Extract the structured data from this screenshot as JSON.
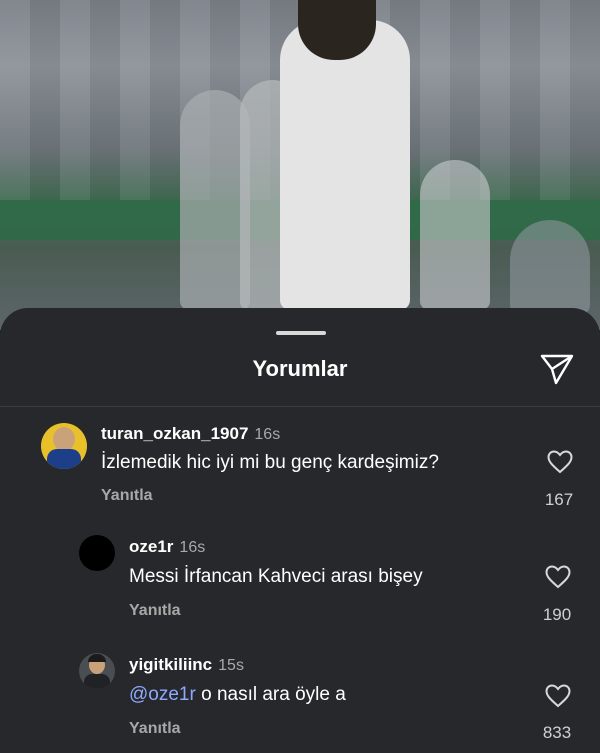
{
  "sheet": {
    "title": "Yorumlar",
    "send_icon": "paper-plane-icon"
  },
  "comments": [
    {
      "username": "turan_ozkan_1907",
      "time": "16s",
      "text": "İzlemedik hic iyi mi bu genç kardeşimiz?",
      "reply_label": "Yanıtla",
      "likes": "167",
      "avatar": "photo-avatar"
    },
    {
      "username": "oze1r",
      "time": "16s",
      "text": "Messi İrfancan Kahveci arası bişey",
      "reply_label": "Yanıtla",
      "likes": "190",
      "avatar": "black-avatar"
    },
    {
      "username": "yigitkiliinc",
      "time": "15s",
      "mention": "@oze1r",
      "text": " o nasıl ara öyle a",
      "reply_label": "Yanıtla",
      "likes": "833",
      "avatar": "photo-avatar"
    }
  ],
  "colors": {
    "background": "#26282b",
    "mention": "#8fa9ff",
    "muted": "#a8a8a8"
  }
}
